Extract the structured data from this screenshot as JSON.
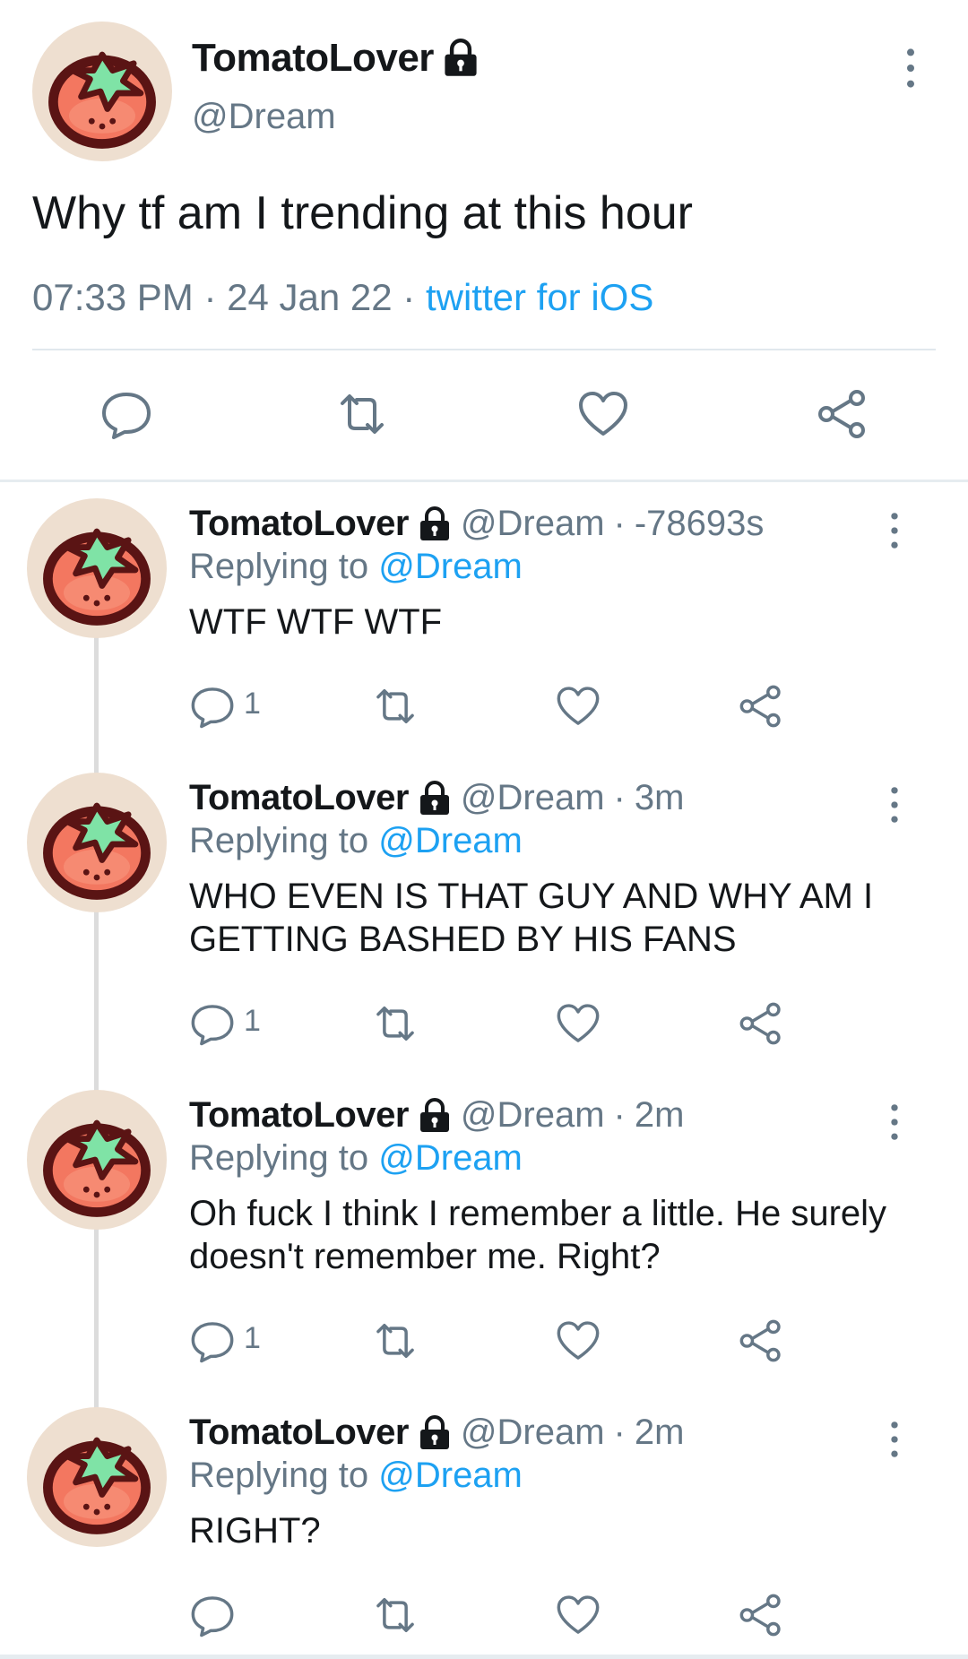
{
  "main_tweet": {
    "display_name": "TomatoLover",
    "handle": "@Dream",
    "text": "Why tf am I trending at this hour",
    "time": "07:33 PM",
    "date": "24 Jan 22",
    "source": "twitter for iOS",
    "meta_separator": "·"
  },
  "replies": [
    {
      "display_name": "TomatoLover",
      "handle": "@Dream",
      "time": "-78693s",
      "replying_prefix": "Replying to",
      "replying_to": "@Dream",
      "text": "WTF WTF WTF",
      "reply_count": "1"
    },
    {
      "display_name": "TomatoLover",
      "handle": "@Dream",
      "time": "3m",
      "replying_prefix": "Replying to",
      "replying_to": "@Dream",
      "text": "WHO EVEN IS THAT GUY AND WHY AM I GETTING BASHED BY HIS FANS",
      "reply_count": "1"
    },
    {
      "display_name": "TomatoLover",
      "handle": "@Dream",
      "time": "2m",
      "replying_prefix": "Replying to",
      "replying_to": "@Dream",
      "text": "Oh fuck I think I remember a little. He surely doesn't remember me. Right?",
      "reply_count": "1"
    },
    {
      "display_name": "TomatoLover",
      "handle": "@Dream",
      "time": "2m",
      "replying_prefix": "Replying to",
      "replying_to": "@Dream",
      "text": "RIGHT?",
      "reply_count": ""
    }
  ],
  "separator_dot": "·",
  "icons": {
    "lock": "lock-icon",
    "reply": "reply-icon",
    "retweet": "retweet-icon",
    "like": "heart-icon",
    "share": "share-icon",
    "more": "more-vertical-icon"
  },
  "colors": {
    "text": "#14171a",
    "muted": "#657786",
    "link": "#1da1f2",
    "icon": "#657786"
  }
}
